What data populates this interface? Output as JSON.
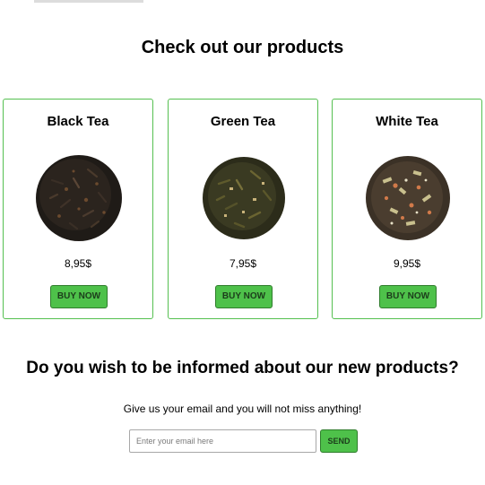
{
  "header": {
    "title": "Check out our products"
  },
  "products": [
    {
      "name": "Black Tea",
      "price": "8,95$",
      "button_label": "BUY NOW",
      "image": "black-tea-leaves"
    },
    {
      "name": "Green Tea",
      "price": "7,95$",
      "button_label": "BUY NOW",
      "image": "green-tea-leaves"
    },
    {
      "name": "White Tea",
      "price": "9,95$",
      "button_label": "BUY NOW",
      "image": "white-tea-leaves"
    }
  ],
  "newsletter": {
    "title": "Do you wish to be informed about our new products?",
    "subtitle": "Give us your email and you will not miss anything!",
    "email_placeholder": "Enter your email here",
    "email_value": "",
    "send_label": "SEND"
  },
  "colors": {
    "accent_green": "#4ec14a",
    "card_border": "#55c050",
    "button_border": "#2f7d2c"
  }
}
